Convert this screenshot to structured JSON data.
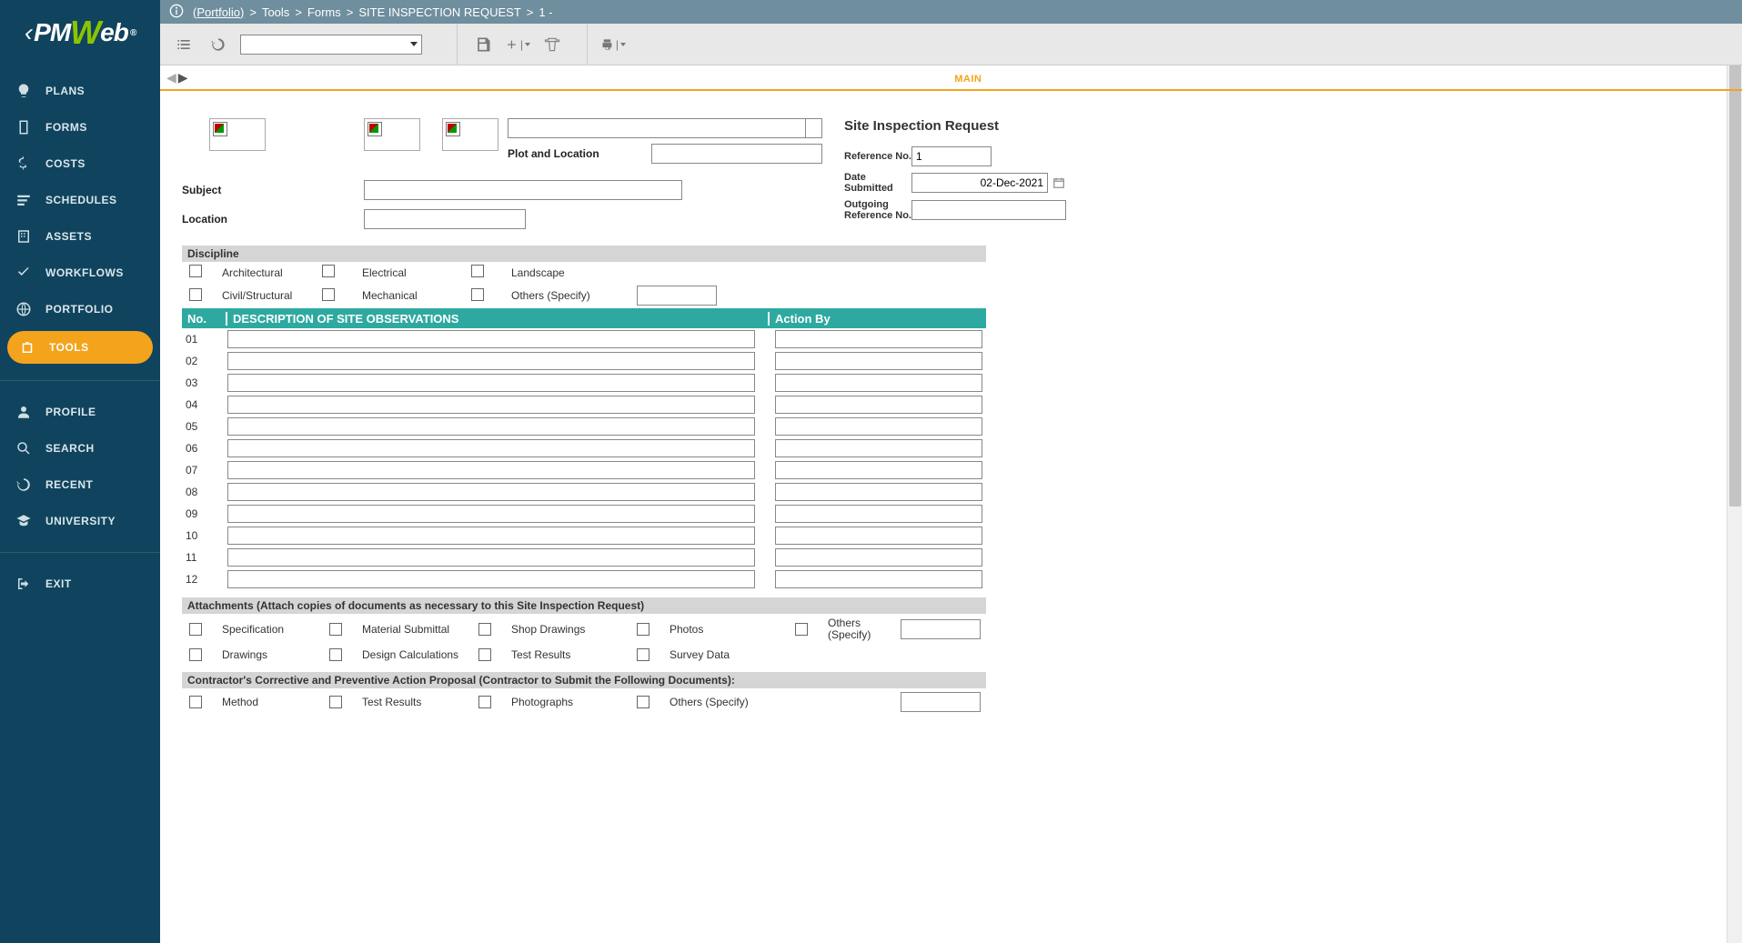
{
  "logo": {
    "bracket": "‹",
    "pm": "PM",
    "w": "W",
    "eb": "eb",
    "reg": "®"
  },
  "breadcrumb": {
    "root": "(Portfolio)",
    "parts": [
      "Tools",
      "Forms",
      "SITE INSPECTION REQUEST",
      "1 -"
    ]
  },
  "sidebar": {
    "items": [
      {
        "label": "PLANS",
        "icon": "plans-icon"
      },
      {
        "label": "FORMS",
        "icon": "forms-icon"
      },
      {
        "label": "COSTS",
        "icon": "costs-icon"
      },
      {
        "label": "SCHEDULES",
        "icon": "schedules-icon"
      },
      {
        "label": "ASSETS",
        "icon": "assets-icon"
      },
      {
        "label": "WORKFLOWS",
        "icon": "workflows-icon"
      },
      {
        "label": "PORTFOLIO",
        "icon": "portfolio-icon"
      },
      {
        "label": "TOOLS",
        "icon": "tools-icon",
        "active": true
      }
    ],
    "items2": [
      {
        "label": "PROFILE",
        "icon": "profile-icon"
      },
      {
        "label": "SEARCH",
        "icon": "search-icon"
      },
      {
        "label": "RECENT",
        "icon": "recent-icon"
      },
      {
        "label": "UNIVERSITY",
        "icon": "university-icon"
      }
    ],
    "items3": [
      {
        "label": "EXIT",
        "icon": "exit-icon"
      }
    ]
  },
  "tabs": {
    "main": "MAIN"
  },
  "form": {
    "title": "Site Inspection Request",
    "plot_label": "Plot and Location",
    "subject_label": "Subject",
    "location_label": "Location",
    "ref_label": "Reference No.",
    "ref_value": "1",
    "date_label": "Date Submitted",
    "date_value": "02-Dec-2021",
    "outref_label": "Outgoing Reference No.",
    "discipline_header": "Discipline",
    "disciplines": {
      "architectural": "Architectural",
      "electrical": "Electrical",
      "landscape": "Landscape",
      "civil": "Civil/Structural",
      "mechanical": "Mechanical",
      "others": "Others (Specify)"
    },
    "obs_header": {
      "no": "No.",
      "desc": "DESCRIPTION OF SITE OBSERVATIONS",
      "action": "Action By"
    },
    "obs_rows": [
      "01",
      "02",
      "03",
      "04",
      "05",
      "06",
      "07",
      "08",
      "09",
      "10",
      "11",
      "12"
    ],
    "attachments_header": "Attachments (Attach copies of documents as necessary to this Site Inspection Request)",
    "attachments": {
      "spec": "Specification",
      "material": "Material Submittal",
      "shop": "Shop Drawings",
      "photos": "Photos",
      "others": "Others (Specify)",
      "drawings": "Drawings",
      "design": "Design Calculations",
      "test": "Test Results",
      "survey": "Survey Data"
    },
    "corrective_header": "Contractor's Corrective and Preventive Action Proposal (Contractor to Submit the Following Documents):",
    "corrective": {
      "method": "Method",
      "test": "Test Results",
      "photos": "Photographs",
      "others": "Others (Specify)"
    }
  }
}
